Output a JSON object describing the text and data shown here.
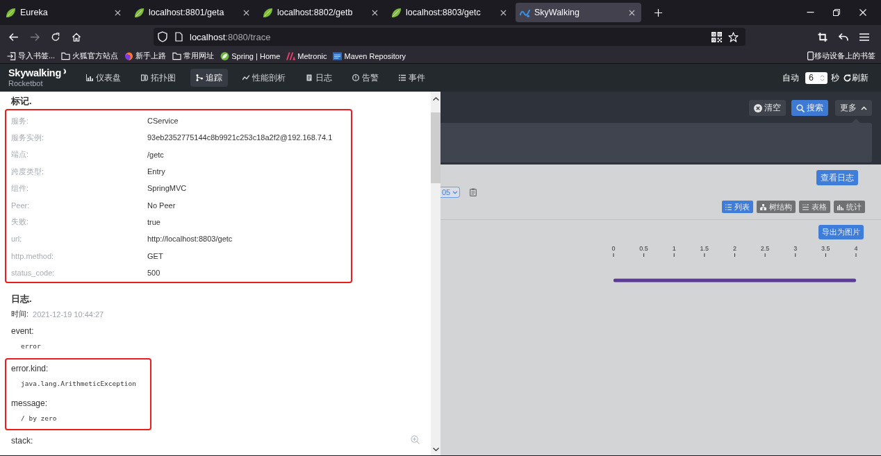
{
  "browser": {
    "tabs": [
      {
        "title": "Eureka",
        "kind": "leaf",
        "selected": false
      },
      {
        "title": "localhost:8801/geta",
        "kind": "leaf",
        "selected": false
      },
      {
        "title": "localhost:8802/getb",
        "kind": "leaf",
        "selected": false
      },
      {
        "title": "localhost:8803/getc",
        "kind": "leaf",
        "selected": false
      },
      {
        "title": "SkyWalking",
        "kind": "monogram",
        "selected": true
      }
    ],
    "address": {
      "host": "localhost",
      "path": ":8080/trace"
    },
    "bookmarks": [
      {
        "label": "导入书签...",
        "kind": "import"
      },
      {
        "label": "火狐官方站点",
        "kind": "folder"
      },
      {
        "label": "新手上路",
        "kind": "globe"
      },
      {
        "label": "常用网址",
        "kind": "folder"
      },
      {
        "label": "Spring | Home",
        "kind": "leaf"
      },
      {
        "label": "Metronic",
        "kind": "peaks"
      },
      {
        "label": "Maven Repository",
        "kind": "badge"
      }
    ],
    "mobile_bookmarks": "移动设备上的书签"
  },
  "app": {
    "logo": {
      "name": "Skywalking",
      "subtitle": "Rocketbot"
    },
    "nav": [
      {
        "label": "仪表盘",
        "kind": "dashboard",
        "selected": false
      },
      {
        "label": "拓扑图",
        "kind": "topology",
        "selected": false
      },
      {
        "label": "追踪",
        "kind": "trace",
        "selected": true
      },
      {
        "label": "性能剖析",
        "kind": "profile",
        "selected": false
      },
      {
        "label": "日志",
        "kind": "log",
        "selected": false
      },
      {
        "label": "告警",
        "kind": "alarm",
        "selected": false
      },
      {
        "label": "事件",
        "kind": "event",
        "selected": false
      }
    ],
    "auto_refresh": {
      "label": "自动",
      "value": "6",
      "unit": "秒",
      "button": "刷新"
    }
  },
  "trace": {
    "clear_button": "清空",
    "search_button": "搜索",
    "more": {
      "label": "更多",
      "expanded": true
    },
    "view_logs_button": "查看日志",
    "select_value": "05",
    "views": [
      {
        "label": "列表",
        "kind": "list",
        "selected": true
      },
      {
        "label": "树结构",
        "kind": "tree",
        "selected": false
      },
      {
        "label": "表格",
        "kind": "table",
        "selected": false
      },
      {
        "label": "统计",
        "kind": "stats",
        "selected": false
      }
    ],
    "export_button": "导出为图片",
    "chart_data": {
      "type": "bar",
      "orientation": "horizontal",
      "categories": [
        null
      ],
      "xlim": [
        0,
        4
      ],
      "xticks": [
        0,
        0.5,
        1,
        1.5,
        2,
        2.5,
        3,
        3.5,
        4
      ],
      "series": [
        {
          "color": "#5b3a96",
          "values": [
            4
          ]
        }
      ]
    }
  },
  "span_detail": {
    "tags": {
      "title": "标记.",
      "highlighted": true,
      "rows": [
        {
          "label": "服务:",
          "value": "CService"
        },
        {
          "label": "服务实例:",
          "value": "93eb2352775144c8b9921c253c18a2f2@192.168.74.1"
        },
        {
          "label": "端点:",
          "value": "/getc"
        },
        {
          "label": "跨度类型:",
          "value": "Entry"
        },
        {
          "label": "组件:",
          "value": "SpringMVC"
        },
        {
          "label": "Peer:",
          "value": "No Peer"
        },
        {
          "label": "失败:",
          "value": "true"
        },
        {
          "label": "url:",
          "value": "http://localhost:8803/getc"
        },
        {
          "label": "http.method:",
          "value": "GET"
        },
        {
          "label": "status_code:",
          "value": "500"
        }
      ]
    },
    "logs": {
      "title": "日志.",
      "time_label": "时间:",
      "time": "2021-12-19 10:44:27",
      "groups": [
        {
          "highlighted": false,
          "fields": [
            {
              "key": "event:",
              "value": "error"
            }
          ]
        },
        {
          "highlighted": true,
          "fields": [
            {
              "key": "error.kind:",
              "value": "java.lang.ArithmeticException"
            },
            {
              "key": "message:",
              "value": "/ by zero"
            }
          ]
        },
        {
          "highlighted": false,
          "fields": [
            {
              "key": "stack:"
            }
          ]
        }
      ]
    }
  }
}
